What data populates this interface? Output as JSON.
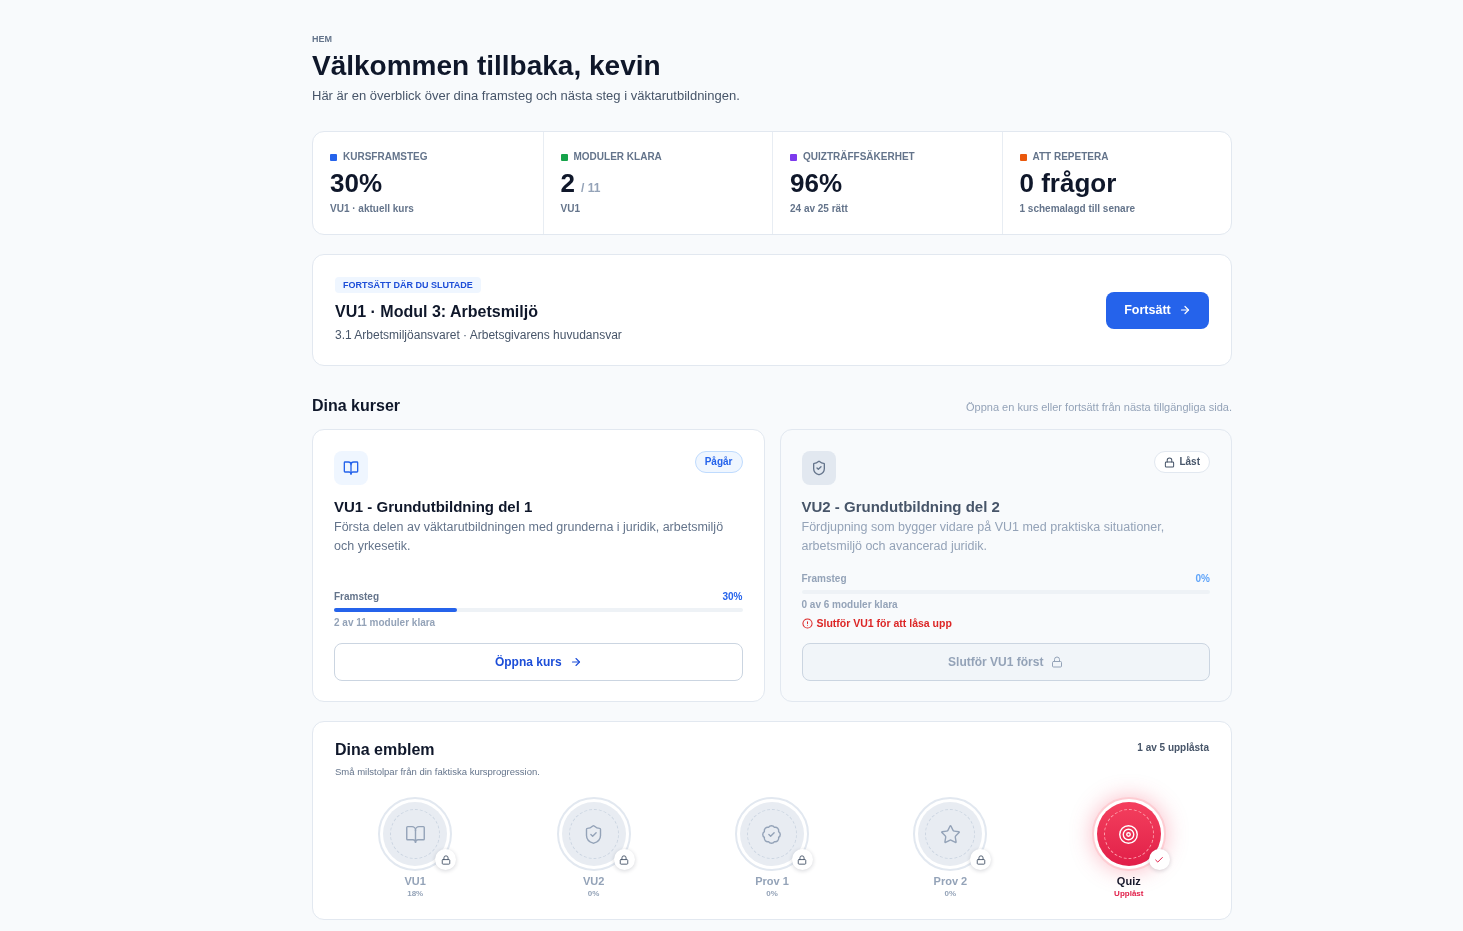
{
  "breadcrumb": "HEM",
  "title": "Välkommen tillbaka, kevin",
  "subtitle": "Här är en överblick över dina framsteg och nästa steg i väktarutbildningen.",
  "stats": [
    {
      "label": "KURSFRAMSTEG",
      "color": "#2563eb",
      "value": "30%",
      "sub": "VU1 · aktuell kurs"
    },
    {
      "label": "MODULER KLARA",
      "color": "#16a34a",
      "value": "2",
      "suffix": "/ 11",
      "sub": "VU1"
    },
    {
      "label": "QUIZTRÄFFSÄKERHET",
      "color": "#7c3aed",
      "value": "96%",
      "sub": "24 av 25 rätt"
    },
    {
      "label": "ATT REPETERA",
      "color": "#ea580c",
      "value": "0 frågor",
      "sub": "1 schemalagd till senare"
    }
  ],
  "resume": {
    "tag": "FORTSÄTT DÄR DU SLUTADE",
    "title": "VU1 · Modul 3: Arbetsmiljö",
    "subtitle": "3.1 Arbetsmiljöansvaret · Arbetsgivarens huvudansvar",
    "button": "Fortsätt"
  },
  "courses_section": {
    "title": "Dina kurser",
    "hint": "Öppna en kurs eller fortsätt från nästa tillgängliga sida."
  },
  "courses": [
    {
      "locked": false,
      "status": "Pågår",
      "title": "VU1 - Grundutbildning del 1",
      "description": "Första delen av väktarutbildningen med grunderna i juridik, arbetsmiljö och yrkesetik.",
      "progress_label": "Framsteg",
      "progress_value": "30%",
      "level": 0.3,
      "modules": "2 av 11 moduler klara",
      "button": "Öppna kurs"
    },
    {
      "locked": true,
      "status": "Låst",
      "title": "VU2 - Grundutbildning del 2",
      "description": "Fördjupning som bygger vidare på VU1 med praktiska situationer, arbetsmiljö och avancerad juridik.",
      "progress_label": "Framsteg",
      "progress_value": "0%",
      "level": 0,
      "modules": "0 av 6 moduler klara",
      "warning": "Slutför VU1 för att låsa upp",
      "button": "Slutför VU1 först"
    }
  ],
  "emblems": {
    "title": "Dina emblem",
    "subtitle": "Små milstolpar från din faktiska kursprogression.",
    "count": "1 av 5 upplåsta",
    "items": [
      {
        "label": "VU1",
        "reading": "18%",
        "unlocked": false
      },
      {
        "label": "VU2",
        "reading": "0%",
        "unlocked": false
      },
      {
        "label": "Prov 1",
        "reading": "0%",
        "unlocked": false
      },
      {
        "label": "Prov 2",
        "reading": "0%",
        "unlocked": false
      },
      {
        "label": "Quiz",
        "reading": "Upplåst",
        "unlocked": true
      }
    ]
  }
}
